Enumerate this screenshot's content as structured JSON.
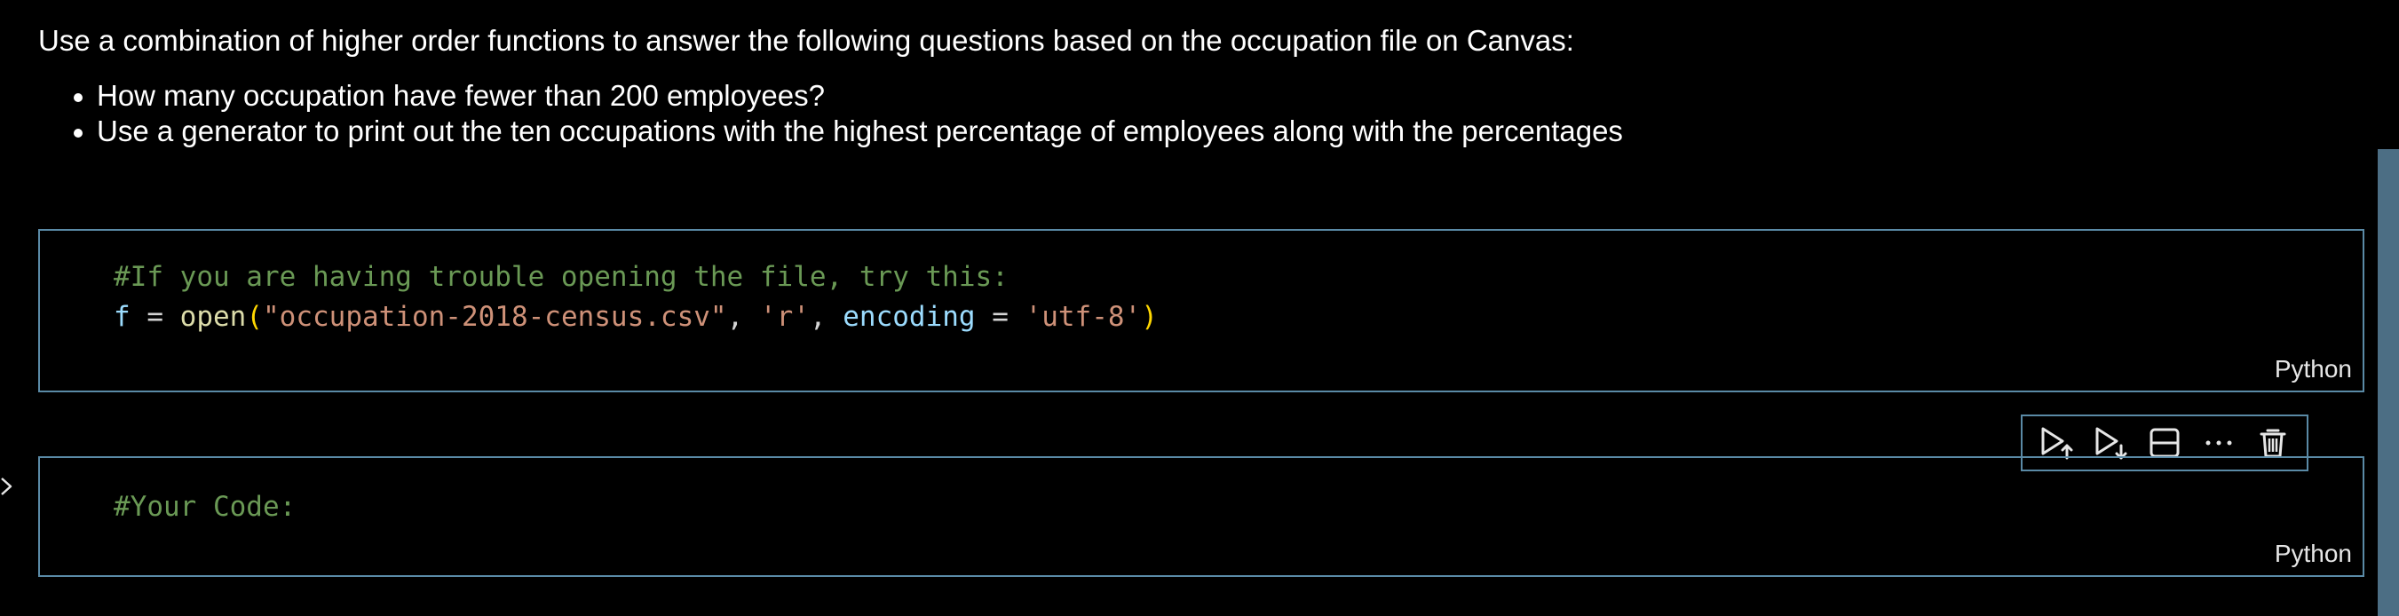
{
  "markdown": {
    "paragraph": "Use a combination of higher order functions to answer the following questions based on the occupation file on Canvas:",
    "bullets": [
      "How many occupation have fewer than 200 employees?",
      "Use a generator to print out the ten occupations with the highest percentage of employees along with the percentages"
    ]
  },
  "cells": [
    {
      "language": "Python",
      "tokens": {
        "comment": "#If you are having trouble opening the file, try this:",
        "var_f": "f",
        "assign": " = ",
        "fn_open": "open",
        "paren_open": "(",
        "str_filename": "\"occupation-2018-census.csv\"",
        "comma1": ", ",
        "str_mode": "'r'",
        "comma2": ", ",
        "kw_encoding": "encoding",
        "assign2": " = ",
        "str_encoding": "'utf-8'",
        "paren_close": ")"
      }
    },
    {
      "language": "Python",
      "tokens": {
        "comment": "#Your Code:"
      }
    }
  ],
  "toolbar": {
    "buttons": [
      "execute-above-icon",
      "execute-below-icon",
      "split-cell-icon",
      "more-actions-icon",
      "delete-cell-icon"
    ]
  },
  "colors": {
    "cell_border": "#5a8aa6",
    "comment": "#6a9955",
    "string": "#ce9178",
    "function": "#dcdcaa",
    "variable": "#9cdcfe",
    "bracket": "#ffd700"
  }
}
